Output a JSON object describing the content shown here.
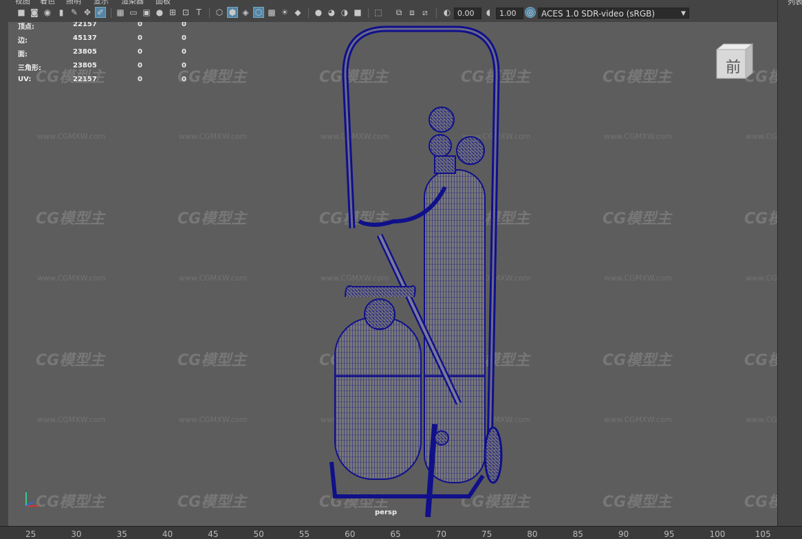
{
  "menu": [
    "视图",
    "着色",
    "照明",
    "显示",
    "渲染器",
    "面板"
  ],
  "toolbar": {
    "exposure": "0.00",
    "gamma": "1.00",
    "color_management": "ACES 1.0 SDR-video (sRGB)"
  },
  "right_panel_label": "列表",
  "hud": [
    {
      "label": "顶点:",
      "v1": "22157",
      "v2": "0",
      "v3": "0"
    },
    {
      "label": "边:",
      "v1": "45137",
      "v2": "0",
      "v3": "0"
    },
    {
      "label": "面:",
      "v1": "23805",
      "v2": "0",
      "v3": "0"
    },
    {
      "label": "三角形:",
      "v1": "23805",
      "v2": "0",
      "v3": "0"
    },
    {
      "label": "UV:",
      "v1": "22157",
      "v2": "0",
      "v3": "0"
    }
  ],
  "viewcube_label": "前",
  "camera_label": "persp",
  "watermark": {
    "logo": "CG模型主",
    "url": "www.CGMXW.com"
  },
  "ruler_ticks": [
    "25",
    "30",
    "35",
    "40",
    "45",
    "50",
    "55",
    "60",
    "65",
    "70",
    "75",
    "80",
    "85",
    "90",
    "95",
    "100",
    "105"
  ],
  "colors": {
    "wireframe": "#10108a",
    "viewport": "#5d5d5d",
    "active": "#5285a6"
  }
}
